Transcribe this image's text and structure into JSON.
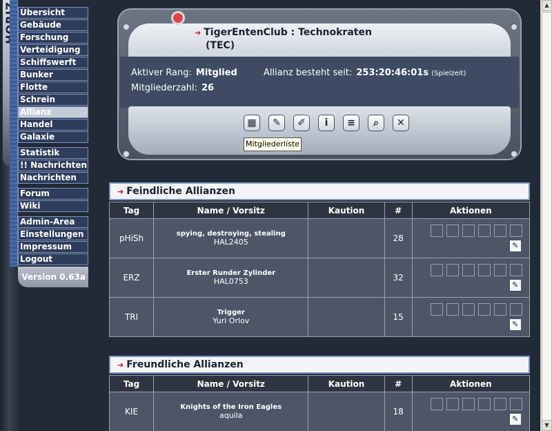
{
  "sidebar": {
    "logo_text": "HORIZ",
    "groups": [
      [
        "Übersicht",
        "Gebäude",
        "Forschung",
        "Verteidigung",
        "Schiffswerft",
        "Bunker",
        "Flotte",
        "Schrein",
        "Allianz",
        "Handel",
        "Galaxie"
      ],
      [
        "Statistik",
        "!! Nachrichten",
        "Nachrichten"
      ],
      [
        "Forum",
        "Wiki"
      ],
      [
        "Admin-Area",
        "Einstellungen",
        "Impressum",
        "Logout"
      ]
    ],
    "active": "Allianz",
    "version": "Version 0.63a"
  },
  "alliance": {
    "name_line1": "TigerEntenClub : Technokraten",
    "name_line2": "(TEC)",
    "rank_label": "Aktiver Rang:",
    "rank_value": "Mitglied",
    "since_label": "Allianz besteht seit:",
    "since_value": "253:20:46:01s",
    "since_note": "(Spielzeit)",
    "members_label": "Mitgliederzahl:",
    "members_value": "26"
  },
  "toolbar": {
    "buttons": [
      {
        "icon": "member-list-icon",
        "glyph": "▦"
      },
      {
        "icon": "diplomacy-icon",
        "glyph": "✎"
      },
      {
        "icon": "edit-icon",
        "glyph": "✐"
      },
      {
        "icon": "info-icon",
        "glyph": "i"
      },
      {
        "icon": "text-icon",
        "glyph": "≡"
      },
      {
        "icon": "search-icon",
        "glyph": "⌕"
      },
      {
        "icon": "close-icon",
        "glyph": "✕"
      }
    ],
    "tooltip": "Mitgliederliste"
  },
  "enemies": {
    "title": "Feindliche Allianzen",
    "headers": [
      "Tag",
      "Name / Vorsitz",
      "Kaution",
      "#",
      "Aktionen"
    ],
    "rows": [
      {
        "tag": "pHiSh",
        "name": "spying, destroying, stealing",
        "leader": "HAL2405",
        "deposit": "",
        "count": "28"
      },
      {
        "tag": "ERZ",
        "name": "Erster Runder Zylinder",
        "leader": "HAL0753",
        "deposit": "",
        "count": "32"
      },
      {
        "tag": "TRI",
        "name": "Trigger",
        "leader": "Yuri Orlov",
        "deposit": "",
        "count": "15"
      }
    ]
  },
  "friends": {
    "title": "Freundliche Allianzen",
    "headers": [
      "Tag",
      "Name / Vorsitz",
      "Kaution",
      "#",
      "Aktionen"
    ],
    "rows": [
      {
        "tag": "KIE",
        "name": "Knights of the Iron Eagles",
        "leader": "aquila",
        "deposit": "",
        "count": "18"
      }
    ]
  },
  "icons": {
    "arrow": "red-arrow-icon",
    "edit": "edit-icon",
    "scroll_up": "scroll-up-icon",
    "scroll_down": "scroll-down-icon"
  },
  "colors": {
    "menu_border": "#7f93bf",
    "accent_red": "#cc1111",
    "panel_dark": "#3e4b63"
  }
}
